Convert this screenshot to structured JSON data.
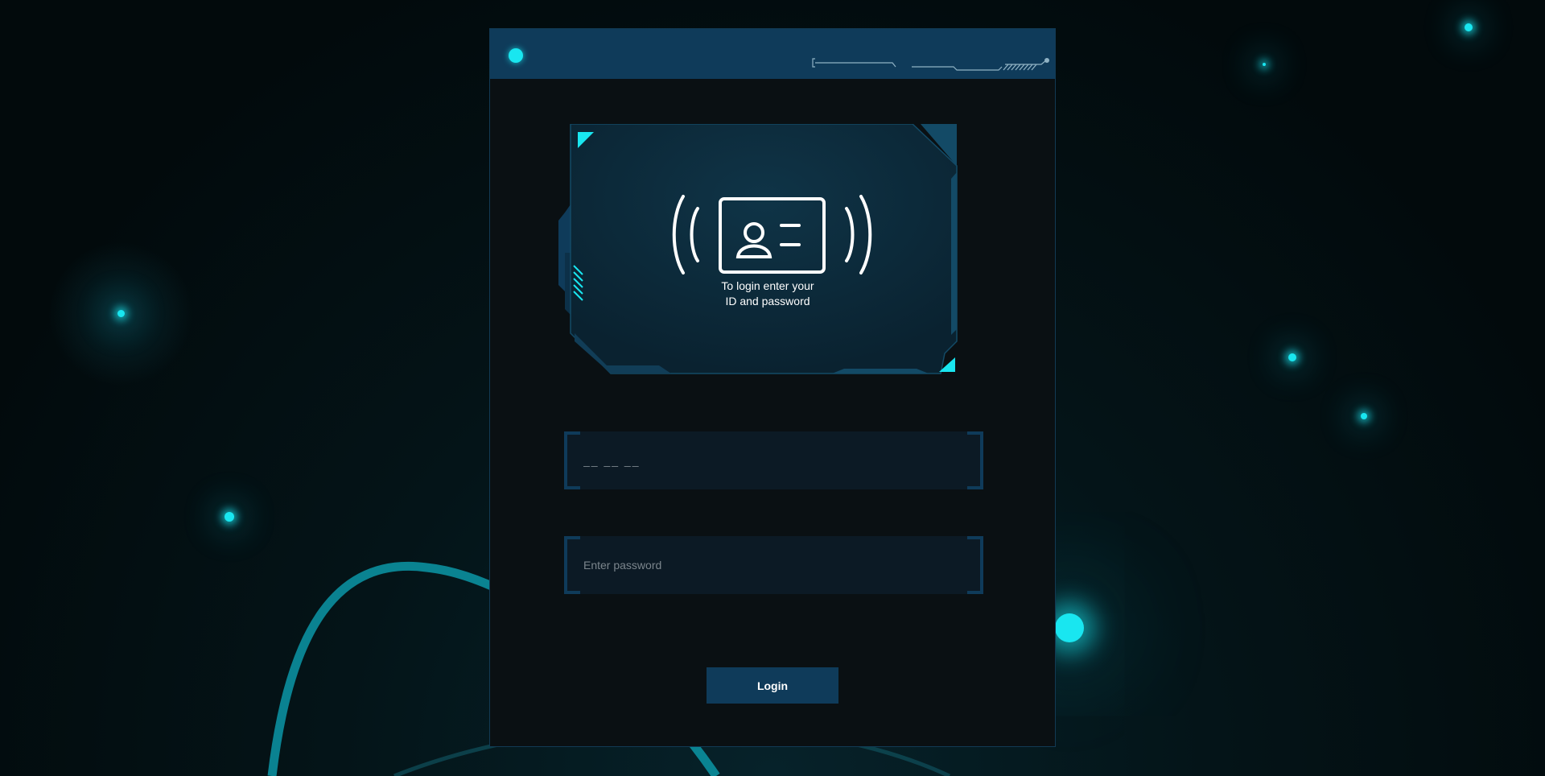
{
  "colors": {
    "accent": "#19e6f0",
    "panel_header": "#0f3b5a",
    "panel_bg": "#0a1013",
    "field_bg": "#0c1a25",
    "button_bg": "#0f3b5a"
  },
  "card": {
    "icon": "id-card-signal-icon",
    "instruction_line1": "To login enter your",
    "instruction_line2": "ID and password"
  },
  "form": {
    "id_placeholder": "__ __ __",
    "password_placeholder": "Enter password",
    "login_label": "Login"
  }
}
